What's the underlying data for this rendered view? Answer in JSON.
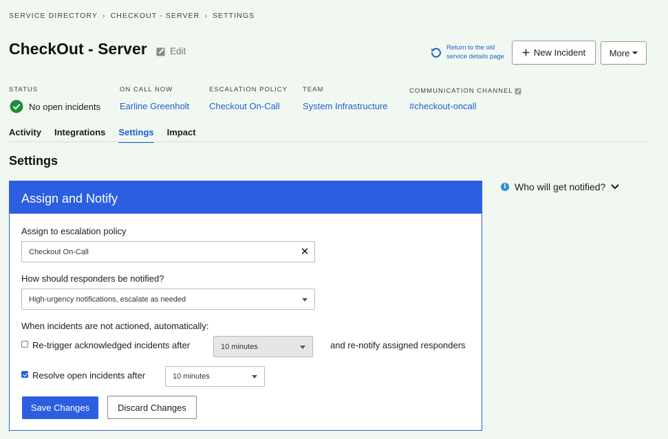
{
  "breadcrumb": {
    "items": [
      "SERVICE DIRECTORY",
      "CHECKOUT - SERVER",
      "SETTINGS"
    ],
    "separator": "›"
  },
  "header": {
    "title": "CheckOut - Server",
    "edit_label": "Edit",
    "old_page_link": [
      "Return to the old",
      "service details page"
    ],
    "new_incident_label": "New Incident",
    "more_label": "More"
  },
  "meta": {
    "status": {
      "label": "STATUS",
      "value": "No open incidents"
    },
    "on_call": {
      "label": "ON CALL NOW",
      "value": "Earline Greenholt"
    },
    "escalation": {
      "label": "ESCALATION POLICY",
      "value": "Checkout On-Call"
    },
    "team": {
      "label": "TEAM",
      "value": "System Infrastructure"
    },
    "channel": {
      "label": "COMMUNICATION CHANNEL",
      "value": "#checkout-oncall"
    }
  },
  "tabs": [
    {
      "label": "Activity",
      "active": false
    },
    {
      "label": "Integrations",
      "active": false
    },
    {
      "label": "Settings",
      "active": true
    },
    {
      "label": "Impact",
      "active": false
    }
  ],
  "section_title": "Settings",
  "panel": {
    "title": "Assign and Notify",
    "escalation_label": "Assign to escalation policy",
    "escalation_value": "Checkout On-Call",
    "notify_label": "How should responders be notified?",
    "notify_value": "High-urgency notifications, escalate as needed",
    "auto_label": "When incidents are not actioned, automatically:",
    "retrigger": {
      "label": "Re-trigger acknowledged incidents after",
      "checked": false,
      "value": "10 minutes",
      "suffix": "and re-notify assigned responders"
    },
    "resolve": {
      "label": "Resolve open incidents after",
      "checked": true,
      "value": "10 minutes"
    },
    "save_label": "Save Changes",
    "discard_label": "Discard Changes"
  },
  "sidebar": {
    "who_label": "Who will get notified?"
  },
  "colors": {
    "accent": "#2b5fe0",
    "link": "#1f5fcf",
    "success": "#1e8c3a",
    "background": "#f1f8f1"
  },
  "icons": [
    "edit-icon",
    "undo-icon",
    "plus-icon",
    "caret-down-icon",
    "check-circle-icon",
    "info-icon",
    "chevron-down-icon",
    "clear-icon"
  ]
}
